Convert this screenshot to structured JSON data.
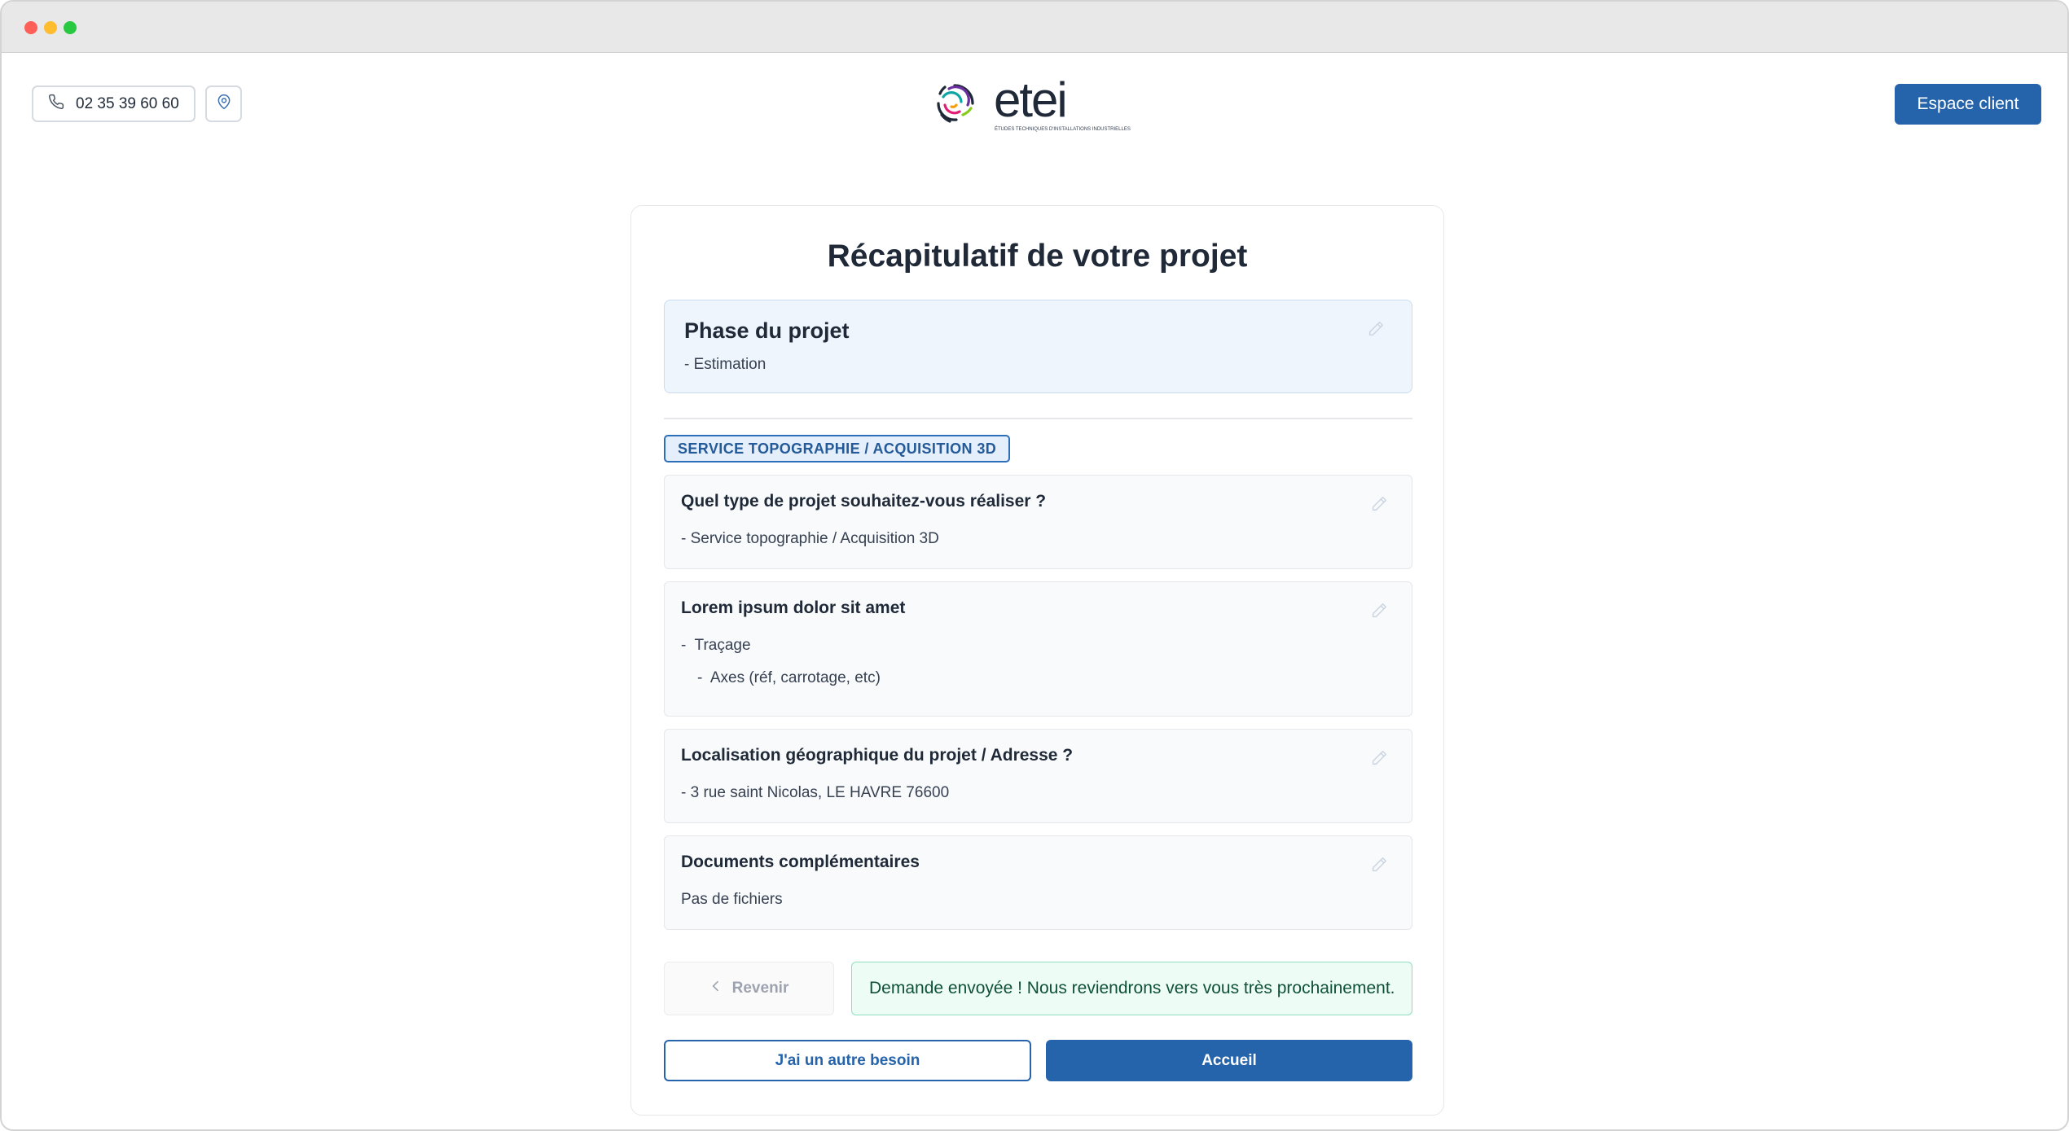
{
  "header": {
    "phone": "02 35 39 60 60",
    "client_button": "Espace client",
    "logo_text": "etei",
    "logo_tagline": "ÉTUDES TECHNIQUES D'INSTALLATIONS INDUSTRIELLES"
  },
  "recap": {
    "title": "Récapitulatif de votre projet",
    "phase": {
      "title": "Phase du projet",
      "value": "- Estimation"
    },
    "service_badge": "SERVICE TOPOGRAPHIE / ACQUISITION 3D",
    "questions": [
      {
        "title": "Quel type de projet souhaitez-vous réaliser ?",
        "lines": [
          "- Service topographie / Acquisition 3D"
        ]
      },
      {
        "title": "Lorem ipsum dolor sit amet",
        "lines": [
          "-  Traçage",
          "-  Axes (réf, carrotage, etc)"
        ]
      },
      {
        "title": "Localisation géographique du projet / Adresse ?",
        "lines": [
          "- 3 rue saint Nicolas, LE HAVRE 76600"
        ]
      },
      {
        "title": "Documents complémentaires",
        "lines": [
          "Pas de fichiers"
        ]
      }
    ],
    "back_button": "Revenir",
    "success_message": "Demande envoyée ! Nous reviendrons vers vous très prochainement.",
    "other_need_button": "J'ai un autre besoin",
    "home_button": "Accueil"
  },
  "icons": {
    "phone": "phone-icon",
    "location": "map-pin-icon",
    "edit": "pencil-icon",
    "back": "chevron-left-icon"
  },
  "colors": {
    "primary": "#2563aa",
    "phase_bg": "#eef5fd",
    "success_bg": "#edfcf5",
    "success_text": "#0f5137"
  }
}
